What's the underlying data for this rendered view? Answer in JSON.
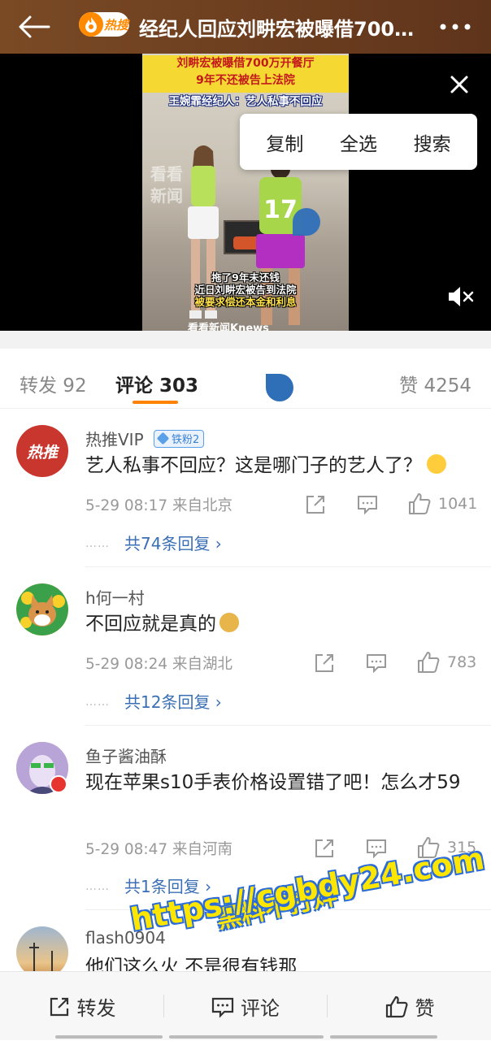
{
  "header": {
    "title": "经纪人回应刘畊宏被曝借700…",
    "hot_badge": "热搜",
    "back_icon": "back-arrow-icon",
    "more_icon": "more-dots-icon"
  },
  "video": {
    "caption_top_line1": "刘畊宏被曝借700万开餐厅",
    "caption_top_line2": "9年不还被告上法院",
    "caption_sub": "王婉霏经纪人：艺人私事不回应",
    "watermark_line1": "看看",
    "watermark_line2": "新闻",
    "caption_bottom_line1": "拖了9年未还钱",
    "caption_bottom_line2": "近日刘畊宏被告到法院",
    "caption_bottom_line3": "被要求偿还本金和利息",
    "logo_text": "看看新闻Knews",
    "jersey_number": "17"
  },
  "context_menu": {
    "copy": "复制",
    "select_all": "全选",
    "search": "搜索"
  },
  "tabs": {
    "repost": "转发 92",
    "comment": "评论 303",
    "like": "赞 4254"
  },
  "comments": [
    {
      "username": "热推VIP",
      "badge": "铁粉2",
      "avatar_text": "热推",
      "text": "艺人私事不回应？这是哪门子的艺人了？",
      "meta": "5-29 08:17  来自北京",
      "likes": "1041",
      "replies": "共74条回复 ›"
    },
    {
      "username": "h何一村",
      "text": "不回应就是真的",
      "meta": "5-29 08:24  来自湖北",
      "likes": "783",
      "replies": "共12条回复 ›"
    },
    {
      "username": "鱼子酱油酥",
      "text": "现在苹果s10手表价格设置错了吧！怎么才59",
      "meta": "5-29 08:47  来自河南",
      "likes": "315",
      "replies": "共1条回复 ›"
    },
    {
      "username": "flash0904",
      "text": "他们这么火 不是很有钱那"
    }
  ],
  "watermark": {
    "line1": "黑料不打烊",
    "line2": "https://cgbdy24.com"
  },
  "bottom_bar": {
    "repost": "转发",
    "comment": "评论",
    "like": "赞"
  },
  "colors": {
    "accent": "#ff8200",
    "link": "#3a6fb5",
    "header_bg": "#6b3d1f"
  }
}
